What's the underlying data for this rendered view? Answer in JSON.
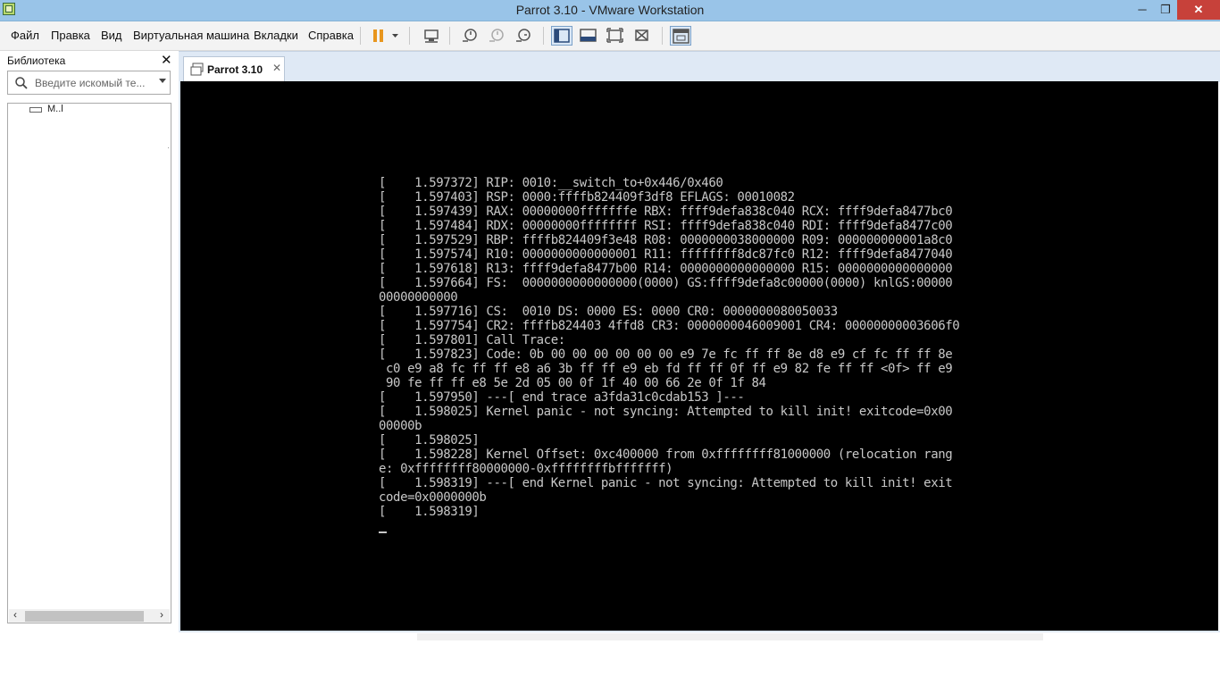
{
  "window": {
    "title": "Parrot 3.10 - VMware Workstation",
    "minimize": "─",
    "maximize": "❐",
    "close": "✕"
  },
  "menu": {
    "items": [
      "Файл",
      "Правка",
      "Вид",
      "Виртуальная машина",
      "Вкладки",
      "Справка"
    ]
  },
  "toolbar": {
    "icons": [
      "pause-icon",
      "dropdown-icon",
      "send-ctrl-alt-del-icon",
      "snapshot-take-icon",
      "snapshot-revert-icon",
      "snapshot-manager-icon",
      "library-view-icon",
      "thumbnail-bar-icon",
      "full-screen-icon",
      "unity-icon",
      "console-view-icon"
    ]
  },
  "library": {
    "title": "Библиотека",
    "close": "✕",
    "search_placeholder": "Введите искомый те...",
    "tree_item": "M..l",
    "scroll_left": "‹",
    "scroll_right": "›"
  },
  "tab": {
    "label": "Parrot 3.10",
    "close": "✕"
  },
  "console_lines": [
    "[    1.597372] RIP: 0010:__switch_to+0x446/0x460",
    "[    1.597403] RSP: 0000:ffffb824409f3df8 EFLAGS: 00010082",
    "[    1.597439] RAX: 00000000fffffffe RBX: ffff9defa838c040 RCX: ffff9defa8477bc0",
    "[    1.597484] RDX: 00000000ffffffff RSI: ffff9defa838c040 RDI: ffff9defa8477c00",
    "[    1.597529] RBP: ffffb824409f3e48 R08: 0000000038000000 R09: 000000000001a8c0",
    "[    1.597574] R10: 0000000000000001 R11: ffffffff8dc87fc0 R12: ffff9defa8477040",
    "[    1.597618] R13: ffff9defa8477b00 R14: 0000000000000000 R15: 0000000000000000",
    "[    1.597664] FS:  0000000000000000(0000) GS:ffff9defa8c00000(0000) knlGS:00000",
    "00000000000",
    "[    1.597716] CS:  0010 DS: 0000 ES: 0000 CR0: 0000000080050033",
    "[    1.597754] CR2: ffffb824403 4ffd8 CR3: 0000000046009001 CR4: 00000000003606f0",
    "[    1.597801] Call Trace:",
    "[    1.597823] Code: 0b 00 00 00 00 00 00 e9 7e fc ff ff 8e d8 e9 cf fc ff ff 8e",
    " c0 e9 a8 fc ff ff e8 a6 3b ff ff e9 eb fd ff ff 0f ff e9 82 fe ff ff <0f> ff e9",
    " 90 fe ff ff e8 5e 2d 05 00 0f 1f 40 00 66 2e 0f 1f 84",
    "[    1.597950] ---[ end trace a3fda31c0cdab153 ]---",
    "[    1.598025] Kernel panic - not syncing: Attempted to kill init! exitcode=0x00",
    "00000b",
    "[    1.598025]",
    "[    1.598228] Kernel Offset: 0xc400000 from 0xffffffff81000000 (relocation rang",
    "e: 0xffffffff80000000-0xffffffffbfffffff)",
    "[    1.598319] ---[ end Kernel panic - not syncing: Attempted to kill init! exit",
    "code=0x0000000b",
    "[    1.598319]"
  ]
}
